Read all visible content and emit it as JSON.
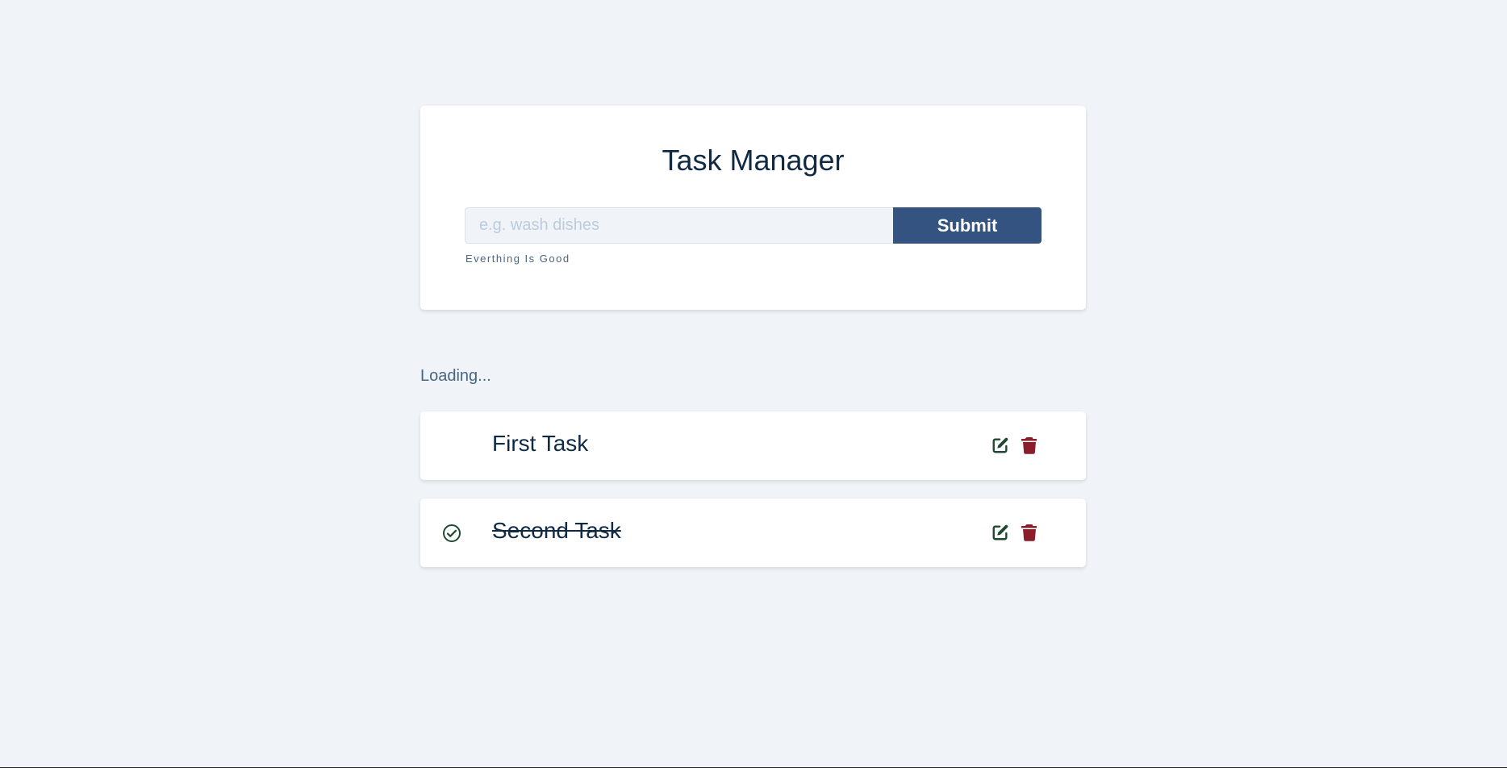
{
  "form": {
    "title": "Task Manager",
    "input_placeholder": "e.g. wash dishes",
    "input_value": "",
    "submit_label": "Submit",
    "alert_text": "Everthing Is Good"
  },
  "status": {
    "loading_text": "Loading..."
  },
  "tasks": [
    {
      "name": "First Task",
      "completed": false
    },
    {
      "name": "Second Task",
      "completed": true
    }
  ],
  "colors": {
    "background": "#f0f4f8",
    "primary": "#345381",
    "edit_icon": "#1d4a30",
    "delete_icon": "#8a1f2b",
    "check_icon": "#1d4a30",
    "title_text": "#102a43"
  },
  "icons": {
    "complete": "check-circle-icon",
    "edit": "edit-icon",
    "delete": "trash-icon"
  }
}
